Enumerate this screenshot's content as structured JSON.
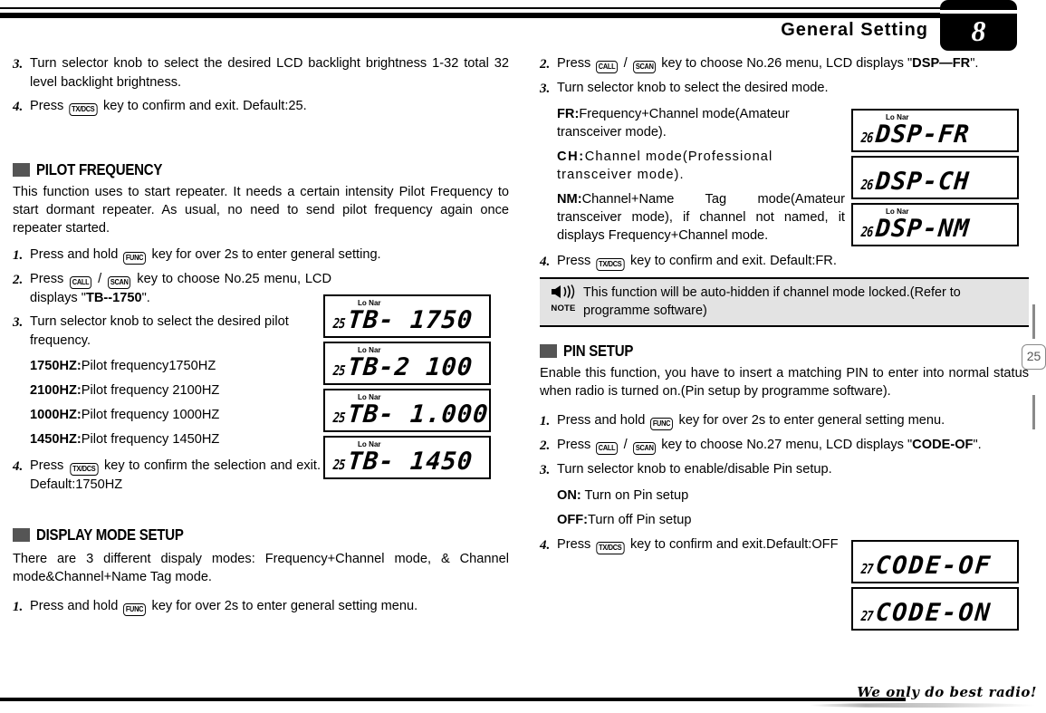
{
  "header": {
    "title": "General Setting",
    "chapter": "8"
  },
  "page_number": "25",
  "footer": {
    "tagline": "We only do best radio!"
  },
  "left_column": {
    "continued_steps": [
      {
        "num": "3.",
        "text": "Turn selector knob to select the desired LCD backlight brightness 1-32 total 32 level backlight brightness."
      },
      {
        "num": "4.",
        "pre": "Press",
        "key": "TX/DCS",
        "post": "key to confirm and exit. Default:25."
      }
    ],
    "pilot_frequency": {
      "heading": "PILOT FREQUENCY",
      "intro": "This function uses to start repeater. It needs a certain intensity Pilot Frequency to start dormant repeater. As usual, no need to send pilot frequency again once repeater started.",
      "step1": {
        "num": "1.",
        "pre": "Press and hold",
        "key": "FUNC",
        "post": "key for over 2s to enter general setting."
      },
      "step2": {
        "num": "2.",
        "pre": "Press",
        "key1": "CALL",
        "sep": "/",
        "key2": "SCAN",
        "post": "key to choose No.25 menu, LCD displays \"",
        "bold": "TB--1750",
        "tail": "\"."
      },
      "step3": {
        "num": "3.",
        "text": "Turn selector knob to select the desired pilot frequency."
      },
      "options": [
        {
          "label": "1750HZ:",
          "desc": "Pilot frequency1750HZ"
        },
        {
          "label": "2100HZ:",
          "desc": "Pilot frequency 2100HZ"
        },
        {
          "label": "1000HZ:",
          "desc": "Pilot frequency 1000HZ"
        },
        {
          "label": "1450HZ:",
          "desc": "Pilot frequency 1450HZ"
        }
      ],
      "step4": {
        "num": "4.",
        "pre": "Press",
        "key": "TX/DCS",
        "post": "key to confirm the selection and exit. Default:1750HZ"
      },
      "lcd_panels": [
        {
          "lonar": "Lo Nar",
          "index": "25",
          "text": "TB- 1750"
        },
        {
          "lonar": "Lo Nar",
          "index": "25",
          "text": "TB-2 100"
        },
        {
          "lonar": "Lo Nar",
          "index": "25",
          "text": "TB- 1.000"
        },
        {
          "lonar": "Lo Nar",
          "index": "25",
          "text": "TB- 1450"
        }
      ]
    },
    "display_mode_setup": {
      "heading": "DISPLAY MODE SETUP",
      "intro": "There are 3 different dispaly modes: Frequency+Channel mode, & Channel mode&Channel+Name Tag mode.",
      "step1": {
        "num": "1.",
        "pre": "Press and hold",
        "key": "FUNC",
        "post": "key for over 2s to enter general setting menu."
      }
    }
  },
  "right_column": {
    "display_mode_cont": {
      "step2": {
        "num": "2.",
        "pre": "Press",
        "key1": "CALL",
        "sep": "/",
        "key2": "SCAN",
        "post": "key to choose No.26 menu, LCD displays \"",
        "bold": "DSP—FR",
        "tail": "\"."
      },
      "step3": {
        "num": "3.",
        "text": "Turn selector knob to select the desired mode."
      },
      "options": [
        {
          "label": "FR:",
          "desc": "Frequency+Channel mode(Amateur transceiver mode)."
        },
        {
          "label": "CH:",
          "desc": "Channel mode(Professional transceiver mode)."
        },
        {
          "label": "NM:",
          "desc": "Channel+Name Tag mode(Amateur transceiver mode), if channel not named, it displays Frequency+Channel mode."
        }
      ],
      "step4": {
        "num": "4.",
        "pre": "Press",
        "key": "TX/DCS",
        "post": "key to confirm and exit. Default:FR."
      },
      "lcd_panels": [
        {
          "lonar": "Lo Nar",
          "index": "26",
          "text": "DSP-FR"
        },
        {
          "lonar": "",
          "index": "26",
          "text": "DSP-CH"
        },
        {
          "lonar": "Lo Nar",
          "index": "26",
          "text": "DSP-NM"
        }
      ]
    },
    "note": {
      "label": "NOTE",
      "icon": "speaker-icon",
      "text": "This function will be auto-hidden if channel mode locked.(Refer to programme software)"
    },
    "pin_setup": {
      "heading": "PIN SETUP",
      "intro": "Enable this function, you have to insert a matching PIN to enter into normal status when radio is turned on.(Pin setup by programme software).",
      "step1": {
        "num": "1.",
        "pre": "Press and hold",
        "key": "FUNC",
        "post": "key for over 2s to enter general setting menu."
      },
      "step2": {
        "num": "2.",
        "pre": "Press",
        "key1": "CALL",
        "sep": "/",
        "key2": "SCAN",
        "post": "key to choose No.27 menu, LCD displays \"",
        "bold": "CODE-OF",
        "tail": "\"."
      },
      "step3": {
        "num": "3.",
        "text": "Turn selector knob to enable/disable Pin setup."
      },
      "options": [
        {
          "label": "ON:",
          "desc": " Turn on Pin setup"
        },
        {
          "label": "OFF:",
          "desc": "Turn off Pin setup"
        }
      ],
      "step4": {
        "num": "4.",
        "pre": "Press",
        "key": "TX/DCS",
        "post": "key to confirm and exit.Default:OFF"
      },
      "lcd_panels": [
        {
          "lonar": "",
          "index": "27",
          "text": "CODE-OF"
        },
        {
          "lonar": "",
          "index": "27",
          "text": "CODE-ON"
        }
      ]
    }
  }
}
